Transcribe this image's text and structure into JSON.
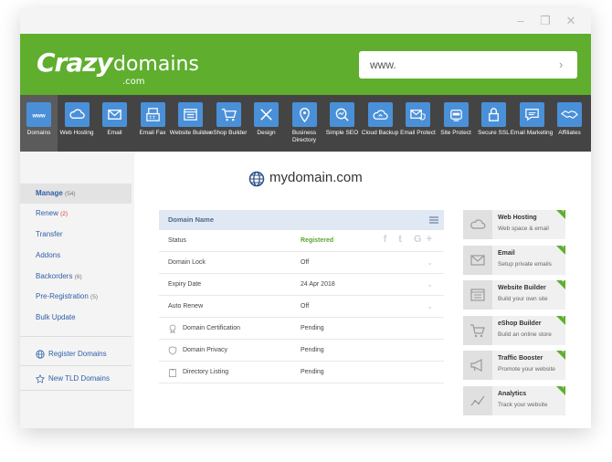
{
  "window": {
    "controls": [
      "–",
      "❐",
      "✕"
    ]
  },
  "brand": {
    "logo_crazy": "Crazy",
    "logo_domains": "domains",
    "logo_com": ".com",
    "color": "#5fae2e"
  },
  "search": {
    "value": "www.",
    "placeholder": "www."
  },
  "nav": {
    "items": [
      {
        "label": "Domains",
        "icon": "www-icon"
      },
      {
        "label": "Web Hosting",
        "icon": "cloud-icon"
      },
      {
        "label": "Email",
        "icon": "envelope-icon"
      },
      {
        "label": "Email Fax",
        "icon": "fax-icon"
      },
      {
        "label": "Website Builder",
        "icon": "website-icon"
      },
      {
        "label": "eShop Builder",
        "icon": "cart-icon"
      },
      {
        "label": "Design",
        "icon": "design-tools-icon"
      },
      {
        "label": "Business Directory",
        "icon": "map-pin-icon"
      },
      {
        "label": "Simple SEO",
        "icon": "seo-icon"
      },
      {
        "label": "Cloud Backup",
        "icon": "cloud-backup-icon"
      },
      {
        "label": "Email Protect",
        "icon": "email-protect-icon"
      },
      {
        "label": "Site Protect",
        "icon": "robot-icon"
      },
      {
        "label": "Secure SSL",
        "icon": "lock-icon"
      },
      {
        "label": "Email Marketing",
        "icon": "chat-icon"
      },
      {
        "label": "Affiliates",
        "icon": "handshake-icon"
      }
    ]
  },
  "sidebar": {
    "items": [
      {
        "label": "Manage",
        "count": "(54)"
      },
      {
        "label": "Renew",
        "count": "(2)"
      },
      {
        "label": "Transfer",
        "count": ""
      },
      {
        "label": "Addons",
        "count": ""
      },
      {
        "label": "Backorders",
        "count": "(6)"
      },
      {
        "label": "Pre-Registration",
        "count": "(5)"
      },
      {
        "label": "Bulk Update",
        "count": ""
      }
    ],
    "links": [
      {
        "label": "Register Domains",
        "icon": "globe-icon"
      },
      {
        "label": "New TLD Domains",
        "icon": "star-icon"
      }
    ]
  },
  "domain": {
    "name": "mydomain.com"
  },
  "table": {
    "header": "Domain Name",
    "social": "f t G+",
    "rows": [
      {
        "label": "Status",
        "value": "Registered"
      },
      {
        "label": "Domain Lock",
        "value": "Off"
      },
      {
        "label": "Expiry Date",
        "value": "24 Apr 2018"
      },
      {
        "label": "Auto Renew",
        "value": "Off"
      },
      {
        "label": "Domain Certification",
        "value": "Pending"
      },
      {
        "label": "Domain Privacy",
        "value": "Pending"
      },
      {
        "label": "Directory Listing",
        "value": "Pending"
      }
    ]
  },
  "promos": [
    {
      "title": "Web Hosting",
      "subtitle": "Web space & email"
    },
    {
      "title": "Email",
      "subtitle": "Setup private emails"
    },
    {
      "title": "Website Builder",
      "subtitle": "Build your own site"
    },
    {
      "title": "eShop Builder",
      "subtitle": "Build an online store"
    },
    {
      "title": "Traffic Booster",
      "subtitle": "Promote your website"
    },
    {
      "title": "Analytics",
      "subtitle": "Track your website"
    }
  ]
}
